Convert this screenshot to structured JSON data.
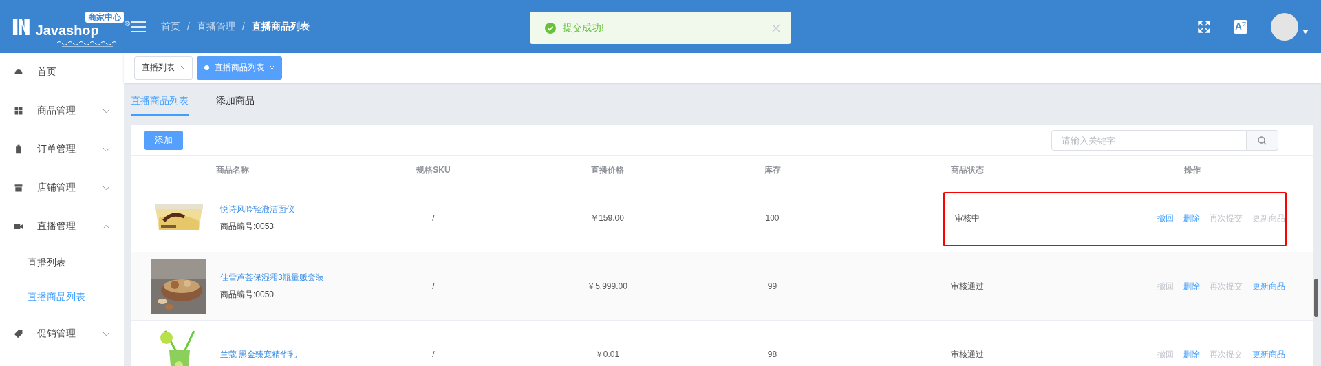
{
  "header": {
    "logo": {
      "badge": "商家中心",
      "name": "Javashop",
      "mark": "®"
    },
    "breadcrumb": [
      {
        "label": "首页",
        "current": false
      },
      {
        "label": "直播管理",
        "current": false
      },
      {
        "label": "直播商品列表",
        "current": true
      }
    ],
    "breadcrumb_separators": [
      "/",
      "/"
    ],
    "toast": {
      "message": "提交成功!"
    }
  },
  "sidebar": {
    "items": [
      {
        "label": "首页",
        "expandable": false
      },
      {
        "label": "商品管理",
        "expandable": true,
        "expanded": false
      },
      {
        "label": "订单管理",
        "expandable": true,
        "expanded": false
      },
      {
        "label": "店铺管理",
        "expandable": true,
        "expanded": false
      },
      {
        "label": "直播管理",
        "expandable": true,
        "expanded": true,
        "children": [
          {
            "label": "直播列表",
            "selected": false
          },
          {
            "label": "直播商品列表",
            "selected": true
          }
        ]
      },
      {
        "label": "促销管理",
        "expandable": true,
        "expanded": false
      }
    ]
  },
  "page_tabs": [
    {
      "label": "直播列表",
      "selected": false
    },
    {
      "label": "直播商品列表",
      "selected": true
    }
  ],
  "sub_tabs": [
    {
      "label": "直播商品列表",
      "selected": true
    },
    {
      "label": "添加商品",
      "selected": false
    }
  ],
  "toolbar": {
    "add_button": "添加",
    "search": {
      "placeholder": "请输入关键字"
    }
  },
  "table": {
    "columns": [
      "商品名称",
      "规格SKU",
      "直播价格",
      "库存",
      "商品状态",
      "操作"
    ],
    "rows": [
      {
        "name": "悦诗风吟轻澈洁面仪",
        "code": "商品编号:0053",
        "sku": "/",
        "price": "￥159.00",
        "stock": "100",
        "status": "审核中",
        "highlighted": true,
        "actions": [
          {
            "label": "撤回",
            "disabled": false
          },
          {
            "label": "删除",
            "disabled": false
          },
          {
            "label": "再次提交",
            "disabled": true
          },
          {
            "label": "更新商品",
            "disabled": true
          }
        ]
      },
      {
        "name": "佳雪芦荟保湿霜3瓶量贩套装",
        "code": "商品编号:0050",
        "sku": "/",
        "price": "￥5,999.00",
        "stock": "99",
        "status": "审核通过",
        "highlighted": false,
        "actions": [
          {
            "label": "撤回",
            "disabled": true
          },
          {
            "label": "删除",
            "disabled": false
          },
          {
            "label": "再次提交",
            "disabled": true
          },
          {
            "label": "更新商品",
            "disabled": false
          }
        ]
      },
      {
        "name": "兰蔻 黑金臻宠精华乳",
        "sku": "/",
        "price": "￥0.01",
        "stock": "98",
        "status": "审核通过",
        "highlighted": false,
        "actions": [
          {
            "label": "撤回",
            "disabled": true
          },
          {
            "label": "删除",
            "disabled": false
          },
          {
            "label": "再次提交",
            "disabled": true
          },
          {
            "label": "更新商品",
            "disabled": false
          }
        ]
      }
    ]
  }
}
